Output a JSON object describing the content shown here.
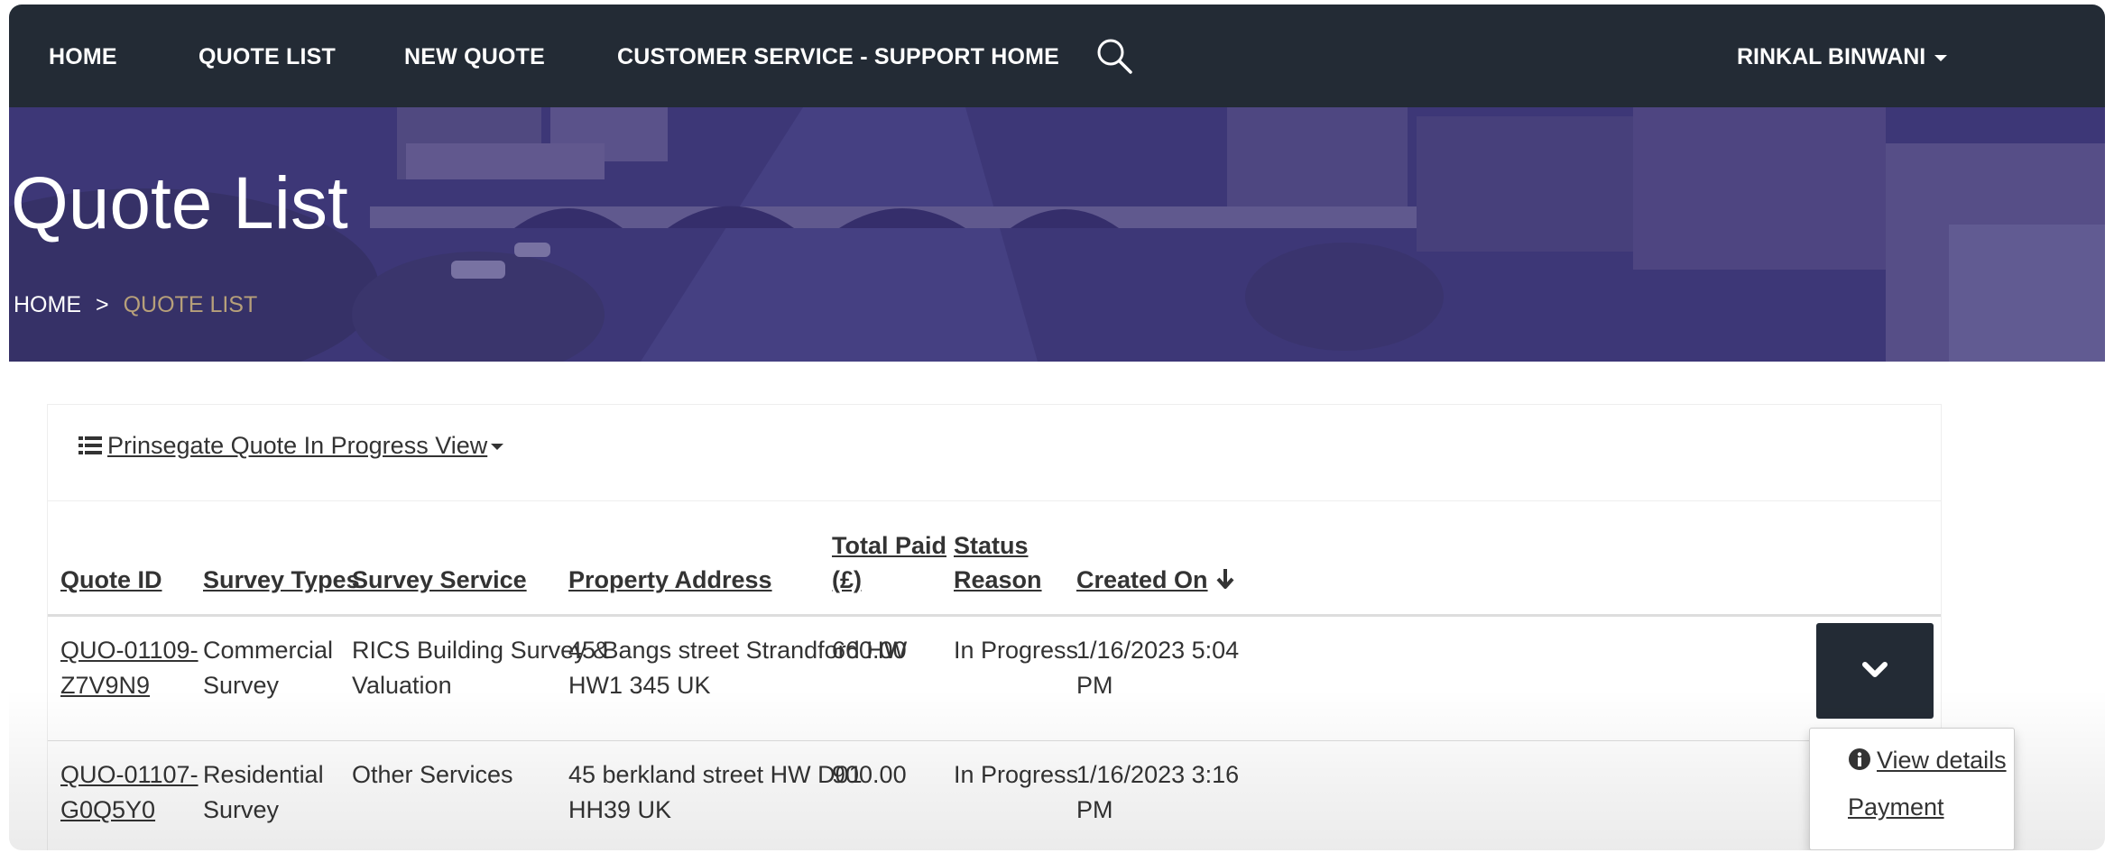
{
  "nav": {
    "items": [
      {
        "label": "HOME"
      },
      {
        "label": "QUOTE LIST"
      },
      {
        "label": "NEW QUOTE"
      },
      {
        "label": "CUSTOMER SERVICE - SUPPORT HOME"
      }
    ],
    "search_icon": "search-icon",
    "user": "RINKAL BINWANI"
  },
  "hero": {
    "title": "Quote List",
    "breadcrumb": {
      "home": "HOME",
      "separator": ">",
      "current": "QUOTE LIST"
    }
  },
  "view": {
    "label": "Prinsegate Quote In Progress View",
    "icon": "list-icon"
  },
  "table": {
    "columns": {
      "quote_id": "Quote ID",
      "survey_types": "Survey Types",
      "survey_service": "Survey Service",
      "property_address": "Property Address",
      "total_paid_1": "Total Paid",
      "total_paid_2": "(£)",
      "status_reason_1": "Status",
      "status_reason_2": "Reason",
      "created_on": "Created On"
    },
    "rows": [
      {
        "quote_id_1": "QUO-01109-",
        "quote_id_2": "Z7V9N9",
        "survey_type_1": "Commercial",
        "survey_type_2": "Survey",
        "service_1": "RICS Building Survey &",
        "service_2": "Valuation",
        "address_1": "45 Bangs street Strandford HW",
        "address_2": "HW1 345 UK",
        "total_paid": "660.00",
        "status": "In Progress",
        "created_1": "1/16/2023 5:04",
        "created_2": "PM"
      },
      {
        "quote_id_1": "QUO-01107-",
        "quote_id_2": "G0Q5Y0",
        "survey_type_1": "Residential",
        "survey_type_2": "Survey",
        "service_1": "Other Services",
        "service_2": "",
        "address_1": "45 berkland street HW D01",
        "address_2": "HH39 UK",
        "total_paid": "900.00",
        "status": "In Progress",
        "created_1": "1/16/2023 3:16",
        "created_2": "PM"
      }
    ]
  },
  "dropdown": {
    "view_details": "View details",
    "payment": "Payment"
  },
  "colors": {
    "navbar": "#232b35",
    "breadcrumb_current": "#b7a07a",
    "hero_overlay": "#2c226e"
  }
}
